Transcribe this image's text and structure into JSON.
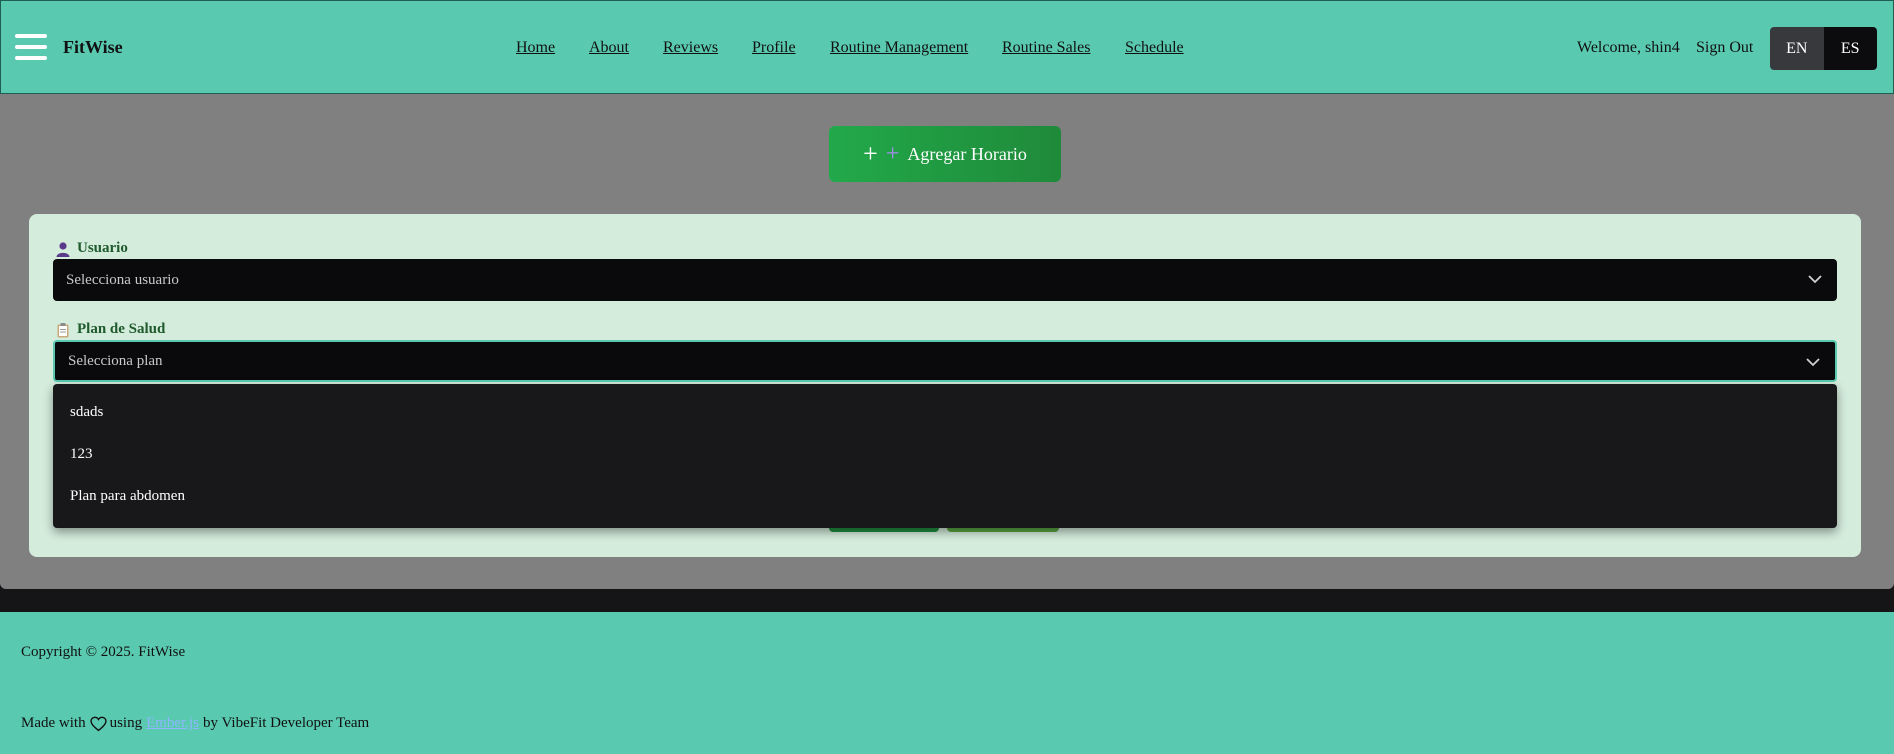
{
  "header": {
    "brand": "FitWise",
    "nav": [
      "Home",
      "About",
      "Reviews",
      "Profile",
      "Routine Management",
      "Routine Sales",
      "Schedule"
    ],
    "welcome": "Welcome, shin4",
    "sign_out": "Sign Out",
    "lang_en": "EN",
    "lang_es": "ES"
  },
  "main": {
    "add_button_label": "Agregar Horario",
    "add_button_icons": [
      "plus-icon",
      "plus-purple-icon"
    ],
    "usuario_label": "Usuario",
    "usuario_icon": "user-icon",
    "usuario_placeholder": "Selecciona usuario",
    "plan_label": "Plan de Salud",
    "plan_icon": "clipboard-icon",
    "plan_placeholder": "Selecciona plan",
    "plan_options": [
      "sdads",
      "123",
      "Plan para abdomen"
    ]
  },
  "footer": {
    "copyright": "Copyright © 2025. FitWise",
    "made_prefix": "Made with",
    "made_using": "using",
    "made_link": "Ember.js",
    "made_suffix": "by VibeFit Developer Team"
  },
  "colors": {
    "header_bg": "#59c9b0",
    "overlay": "#808080",
    "panel_bg": "#d4ecdc",
    "select_bg": "#0a0a0d",
    "add_button": "#22a94a"
  }
}
